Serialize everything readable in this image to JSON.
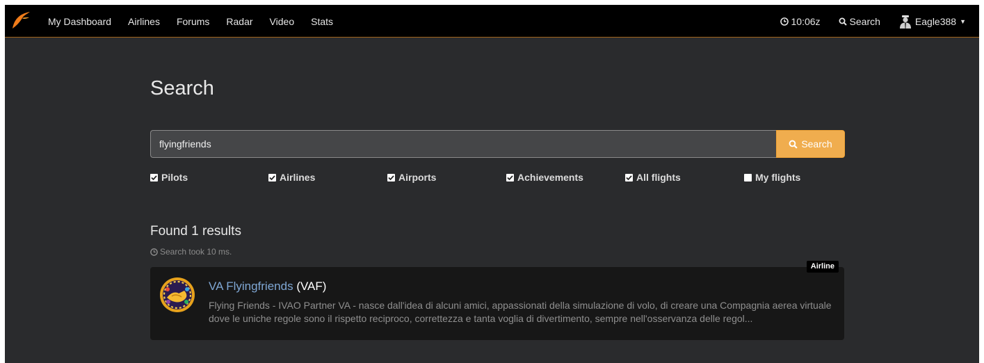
{
  "nav": {
    "links": [
      "My Dashboard",
      "Airlines",
      "Forums",
      "Radar",
      "Video",
      "Stats"
    ],
    "clock": "10:06z",
    "search_label": "Search",
    "username": "Eagle388"
  },
  "page": {
    "title": "Search"
  },
  "search": {
    "value": "flyingfriends",
    "button_label": "Search"
  },
  "filters": [
    {
      "label": "Pilots",
      "checked": true
    },
    {
      "label": "Airlines",
      "checked": true
    },
    {
      "label": "Airports",
      "checked": true
    },
    {
      "label": "Achievements",
      "checked": true
    },
    {
      "label": "All flights",
      "checked": true
    },
    {
      "label": "My flights",
      "checked": false
    }
  ],
  "results": {
    "heading": "Found 1 results",
    "took": "Search took 10 ms.",
    "items": [
      {
        "badge": "Airline",
        "name": "VA Flyingfriends",
        "code": "(VAF)",
        "description": "Flying Friends - IVAO Partner VA - nasce dall'idea di alcuni amici, appassionati della simulazione di volo, di creare una Compagnia aerea virtuale dove le uniche regole sono il rispetto reciproco, correttezza e tanta voglia di divertimento, sempre nell'osservanza delle regol..."
      }
    ]
  },
  "colors": {
    "accent": "#f0ad4e",
    "nav_border": "#a3641c",
    "link": "#7fa7d4",
    "background": "#2a2b2d"
  }
}
